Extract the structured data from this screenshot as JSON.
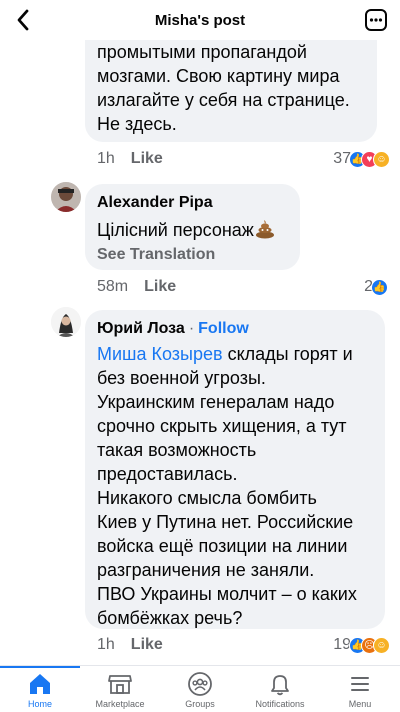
{
  "header": {
    "title": "Misha's post",
    "back_icon": "chevron-left-icon",
    "more_icon": "more-square-icon"
  },
  "comments": [
    {
      "body_lines": [
        "промытыми пропагандой",
        "мозгами.  Свою картину мира",
        "излагайте у себя на странице.",
        "Не здесь."
      ],
      "time": "1h",
      "like": "Like",
      "reaction_count": "37"
    },
    {
      "author": "Alexander Pipa",
      "body": "Цілісний персонаж",
      "body_icon": "poop-emoji",
      "see_translation": "See Translation",
      "time": "58m",
      "like": "Like",
      "reaction_count": "2"
    },
    {
      "author": "Юрий Лоза",
      "dot": "·",
      "follow": "Follow",
      "mention": "Миша Козырев",
      "body_first_line_rest": " склады горят и",
      "body_lines": [
        "без военной угрозы.",
        "Украинским генералам надо",
        "срочно скрыть хищения, а тут",
        "такая возможность",
        "предоставилась.",
        "Никакого смысла бомбить",
        "Киев у Путина нет. Российские",
        "войска ещё позиции на линии",
        "разграничения  не заняли.",
        "ПВО Украины молчит – о каких",
        "бомбёжках речь?"
      ],
      "time": "1h",
      "like": "Like",
      "reaction_count": "19"
    }
  ],
  "tabs": [
    {
      "label": "Home",
      "icon": "home-icon",
      "active": true
    },
    {
      "label": "Marketplace",
      "icon": "marketplace-icon",
      "active": false
    },
    {
      "label": "Groups",
      "icon": "groups-icon",
      "active": false
    },
    {
      "label": "Notifications",
      "icon": "bell-icon",
      "active": false
    },
    {
      "label": "Menu",
      "icon": "menu-icon",
      "active": false
    }
  ],
  "colors": {
    "accent": "#1877f2",
    "bubble": "#f0f2f5",
    "secondary_text": "#65676b"
  }
}
